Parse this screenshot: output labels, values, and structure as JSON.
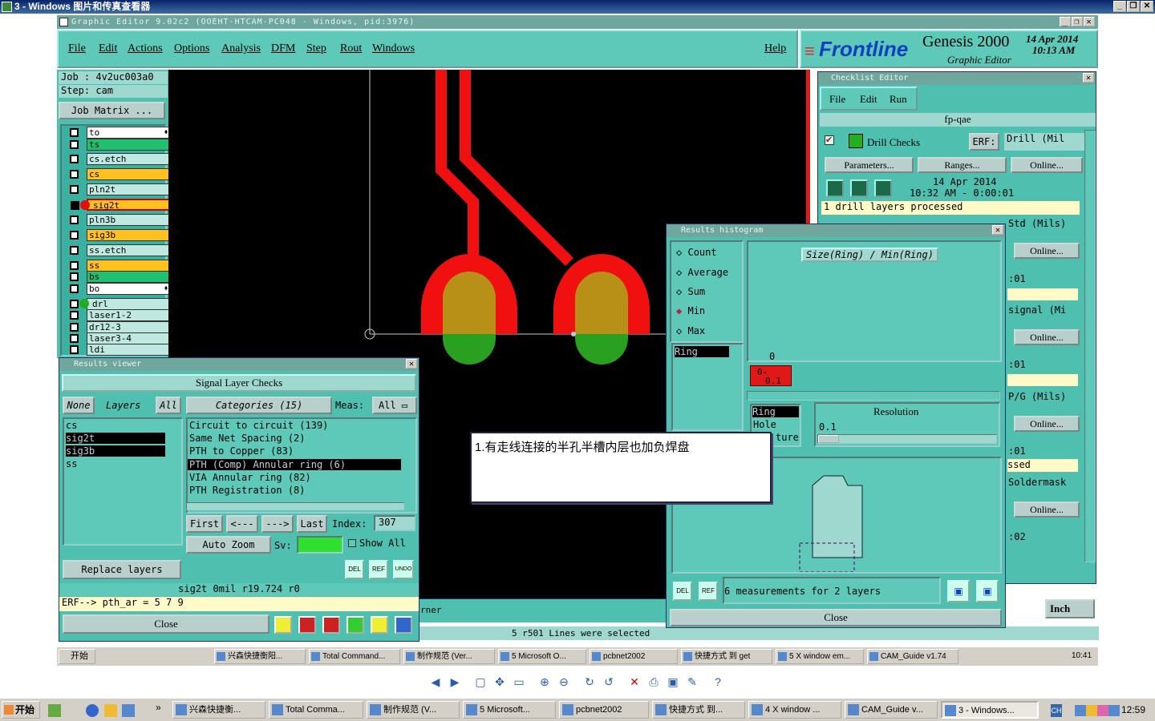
{
  "viewer": {
    "title": "3 - Windows 图片和传真查看器",
    "controls": [
      "_",
      "❐",
      "X"
    ]
  },
  "genesis": {
    "title": "Graphic Editor 9.02c2  (OOEHT-HTCAM-PC048 - Windows, pid:3976)",
    "menus": [
      "File",
      "Edit",
      "Actions",
      "Options",
      "Analysis",
      "DFM",
      "Step",
      "Rout",
      "Windows"
    ],
    "help": "Help",
    "brand": {
      "logo": "Frontline",
      "product": "Genesis 2000",
      "subtitle": "Graphic Editor",
      "date": "14 Apr 2014",
      "time": "10:13  AM"
    },
    "job": "Job  :  4v2uc003a0",
    "step": "Step:  cam",
    "job_matrix": "Job Matrix ...",
    "layers": [
      {
        "name": "to",
        "color": "#ffffff",
        "mark": "⬧"
      },
      {
        "name": "ts",
        "color": "#20c070"
      },
      {
        "name": "cs.etch",
        "color": "#bfe8e0"
      },
      {
        "name": "cs",
        "color": "#ffc020"
      },
      {
        "name": "pln2t",
        "color": "#bfe8e0"
      },
      {
        "name": "sig2t",
        "color": "#ffc020",
        "active": true
      },
      {
        "name": "pln3b",
        "color": "#bfe8e0"
      },
      {
        "name": "sig3b",
        "color": "#ffc020"
      },
      {
        "name": "ss.etch",
        "color": "#bfe8e0"
      },
      {
        "name": "ss",
        "color": "#ffc020"
      },
      {
        "name": "bs",
        "color": "#20c070"
      },
      {
        "name": "bo",
        "color": "#ffffff",
        "mark": "⬧"
      },
      {
        "name": "drl",
        "color": "#bfe8e0",
        "dot": true
      },
      {
        "name": "laser1-2",
        "color": "#bfe8e0"
      },
      {
        "name": "dr12-3",
        "color": "#bfe8e0"
      },
      {
        "name": "laser3-4",
        "color": "#bfe8e0"
      },
      {
        "name": "ldi",
        "color": "#bfe8e0"
      }
    ],
    "inch_label": "Inch",
    "status_selected": "5 r501 Lines were selected",
    "corner_text": "rner"
  },
  "results_viewer": {
    "title": "Results viewer",
    "header": "Signal Layer Checks",
    "none": "None",
    "layers_label": "Layers",
    "all": "All",
    "categories": "Categories (15)",
    "meas_label": "Meas:",
    "meas_value": "All",
    "layer_list": [
      "cs",
      "sig2t",
      "sig3b",
      "ss"
    ],
    "category_list": [
      "Circuit to circuit (139)",
      "Same Net Spacing (2)",
      "PTH to Copper (83)",
      "PTH (Comp) Annular ring (6)",
      "VIA Annular ring (82)",
      "PTH Registration (8)"
    ],
    "nav": [
      "First",
      "<---",
      "--->",
      "Last"
    ],
    "index_label": "Index:",
    "index_value": "307",
    "auto_zoom": "Auto Zoom",
    "sv_label": "Sv:",
    "show_all": "Show All",
    "replace_layers": "Replace layers",
    "icons": [
      "DEL",
      "REF",
      "UNDO"
    ],
    "status1": "sig2t  0mil   r19.724   r0",
    "status2": "ERF--> pth_ar = 5 7 9",
    "close": "Close"
  },
  "checklist": {
    "title": "Checklist Editor",
    "menus": [
      "File",
      "Edit",
      "Run"
    ],
    "name": "fp-qae",
    "drill_checks": "Drill Checks",
    "erf": "ERF:",
    "erf_value": "Drill (Mil",
    "parameters": "Parameters...",
    "ranges": "Ranges...",
    "online": "Online...",
    "date": "14 Apr 2014",
    "time_range": "10:32 AM - 0:00:01",
    "processed": "1 drill layers processed",
    "right_items": [
      "Std (Mils)",
      ":01",
      "signal (Mi",
      ":01",
      "P/G (Mils)",
      ":01",
      "ssed",
      "Soldermask",
      ":02"
    ]
  },
  "histogram": {
    "title": "Results histogram",
    "options": [
      "Count",
      "Average",
      "Sum",
      "Min",
      "Max"
    ],
    "selected_option": "Min",
    "header": "Size(Ring) / Min(Ring)",
    "zero": "0",
    "bar_label_top": "0-",
    "bar_label_bottom": "0.1",
    "ring": "Ring",
    "left_list": [
      "Ring",
      "Hole",
      "ture"
    ],
    "resolution_label": "Resolution",
    "resolution_value": "0.1",
    "measurements": "6 measurements for 2 layers",
    "close": "Close"
  },
  "annotation": {
    "text": "1.有走线连接的半孔半槽内层也加负焊盘"
  },
  "taskbar_inner": {
    "start": "开始",
    "items": [
      "兴森快捷衡阳...",
      "Total Command...",
      "制作规范 (Ver...",
      "5 Microsoft O...",
      "pcbnet2002",
      "快捷方式 到 get",
      "5 X window em...",
      "CAM_Guide v1.74"
    ],
    "clock": "10:41"
  },
  "viewer_toolbar": [
    "prev",
    "next",
    "fit",
    "actual",
    "slideshow",
    "zoom-in",
    "zoom-out",
    "rotate-cw",
    "rotate-ccw",
    "delete",
    "print",
    "save",
    "edit",
    "help"
  ],
  "taskbar": {
    "start": "开始",
    "items": [
      "兴森快捷衡...",
      "Total Comma...",
      "制作规范 (V...",
      "5 Microsoft...",
      "pcbnet2002",
      "快捷方式 到...",
      "4 X window ...",
      "CAM_Guide v...",
      "3 - Windows..."
    ],
    "ime": "CH",
    "clock": "12:59"
  }
}
